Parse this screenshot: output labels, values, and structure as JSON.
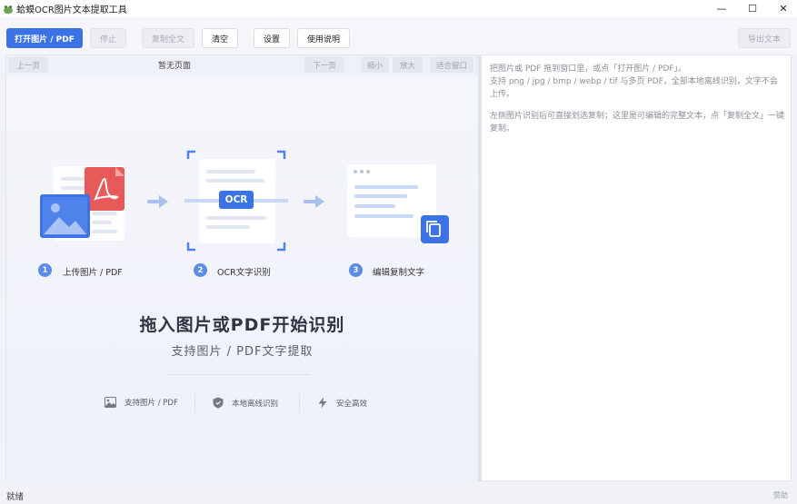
{
  "window": {
    "title": "蛤蟆OCR图片文本提取工具",
    "min_glyph": "—",
    "max_glyph": "☐",
    "close_glyph": "✕"
  },
  "toolbar": {
    "open": "打开图片 / PDF",
    "stop": "停止",
    "copy_all": "复制全文",
    "clear": "清空",
    "settings": "设置",
    "help": "使用说明",
    "export": "导出文本"
  },
  "viewer": {
    "prev": "上一页",
    "page_status": "暂无页面",
    "next": "下一页",
    "zoom_out": "缩小",
    "zoom_in": "放大",
    "fit": "适合窗口"
  },
  "steps": [
    {
      "num": "1",
      "label": "上传图片 / PDF"
    },
    {
      "num": "2",
      "label": "OCR文字识别"
    },
    {
      "num": "3",
      "label": "编辑复制文字"
    }
  ],
  "ocr_badge": "OCR",
  "headline": "拖入图片或PDF开始识别",
  "subline": "支持图片 / PDF文字提取",
  "features": [
    {
      "label": "支持图片 / PDF",
      "icon": "image-icon"
    },
    {
      "label": "本地离线识别",
      "icon": "shield-icon"
    },
    {
      "label": "安全高效",
      "icon": "lightning-icon"
    }
  ],
  "hints": {
    "p1": "把图片或 PDF 拖到窗口里，或点「打开图片 / PDF」。",
    "p2": "支持 png / jpg / bmp / webp / tif 与多页 PDF，全部本地离线识别，文字不会上传。",
    "p3": "左侧图片识别后可直接划选复制；这里是可编辑的完整文本，点「复制全文」一键复制。"
  },
  "status": {
    "text": "就绪",
    "sponsor": "赞助"
  },
  "colors": {
    "accent": "#3b72e6",
    "pdf_red": "#e85a5a",
    "step_blue": "#5b8de8"
  }
}
